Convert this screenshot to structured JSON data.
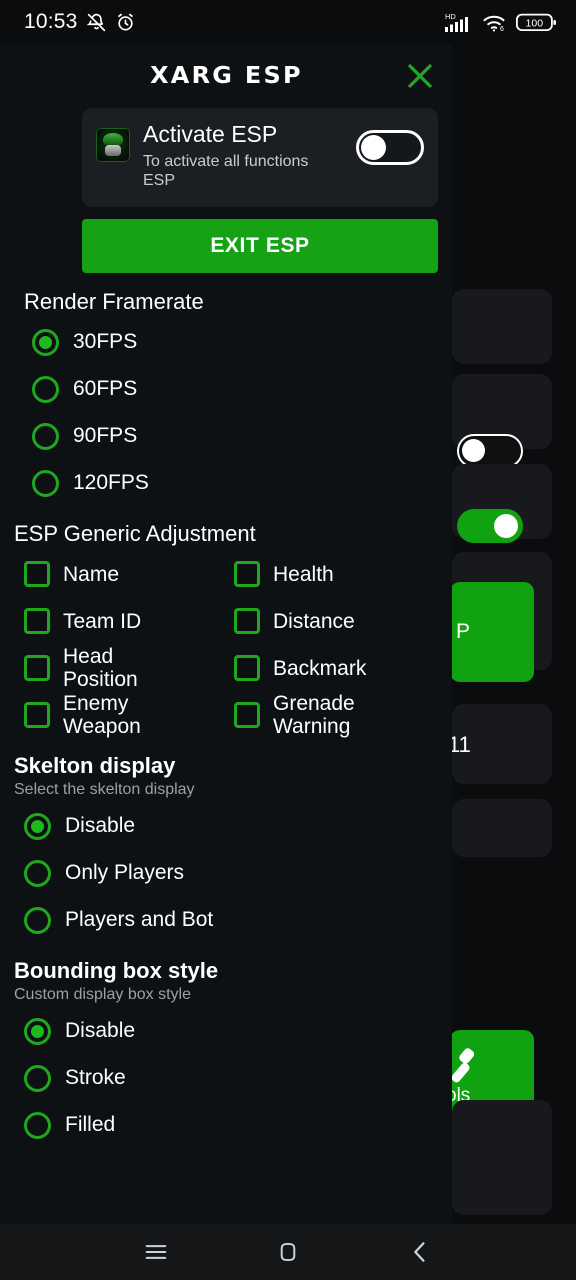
{
  "statusbar": {
    "time": "10:53",
    "left_icons": [
      "silent-bell-icon",
      "alarm-clock-icon"
    ],
    "network_label": "HD",
    "wifi_label": "6",
    "battery_text": "100"
  },
  "sidebar": {
    "items": [
      {
        "icon": "eye-icon",
        "name": "sidebar-item-esp",
        "active": true
      },
      {
        "icon": "location-pin-icon",
        "name": "sidebar-item-location",
        "active": false
      },
      {
        "icon": "car-icon",
        "name": "sidebar-item-vehicle",
        "active": false
      },
      {
        "icon": "crosshair-icon",
        "name": "sidebar-item-aim",
        "active": false
      },
      {
        "icon": "gear-icon",
        "name": "sidebar-item-settings",
        "active": false
      },
      {
        "icon": "cpu-chip-icon",
        "name": "sidebar-item-memory",
        "active": false
      }
    ]
  },
  "panel": {
    "title": "XARG ESP",
    "close_icon": "close-x-icon",
    "activate_card": {
      "icon": "app-logo-icon",
      "title": "Activate ESP",
      "subtitle": "To activate all functions ESP",
      "toggle_state": "off"
    },
    "exit_button": "EXIT ESP",
    "framerate": {
      "heading": "Render Framerate",
      "options": [
        {
          "label": "30FPS",
          "selected": true
        },
        {
          "label": "60FPS",
          "selected": false
        },
        {
          "label": "90FPS",
          "selected": false
        },
        {
          "label": "120FPS",
          "selected": false
        }
      ]
    },
    "generic": {
      "heading": "ESP Generic Adjustment",
      "items": [
        {
          "label": "Name",
          "checked": false
        },
        {
          "label": "Health",
          "checked": false
        },
        {
          "label": "Team ID",
          "checked": false
        },
        {
          "label": "Distance",
          "checked": false
        },
        {
          "label": "Head Position",
          "checked": false
        },
        {
          "label": "Backmark",
          "checked": false
        },
        {
          "label": "Enemy Weapon",
          "checked": false
        },
        {
          "label": "Grenade Warning",
          "checked": false
        }
      ]
    },
    "skeleton": {
      "heading": "Skelton display",
      "subheading": "Select the skelton display",
      "options": [
        {
          "label": "Disable",
          "selected": true
        },
        {
          "label": "Only Players",
          "selected": false
        },
        {
          "label": "Players and Bot",
          "selected": false
        }
      ]
    },
    "bounding": {
      "heading": "Bounding box style",
      "subheading": "Custom display box style",
      "options": [
        {
          "label": "Disable",
          "selected": true
        },
        {
          "label": "Stroke",
          "selected": false
        },
        {
          "label": "Filled",
          "selected": false
        }
      ]
    }
  },
  "background": {
    "partial_texts": {
      "green_button_fragment": "P",
      "counter_fragment": "11",
      "tools_fragment": "ols"
    },
    "toggles": [
      {
        "name": "background-toggle-1",
        "state": "off"
      },
      {
        "name": "background-toggle-2",
        "state": "on"
      }
    ]
  },
  "navbar": {
    "recents_icon": "menu-hamburger-icon",
    "home_icon": "home-square-icon",
    "back_icon": "back-chevron-icon"
  },
  "colors": {
    "accent_green": "#15a215",
    "panel_bg": "#0e1113",
    "card_bg": "#1b1e22"
  }
}
